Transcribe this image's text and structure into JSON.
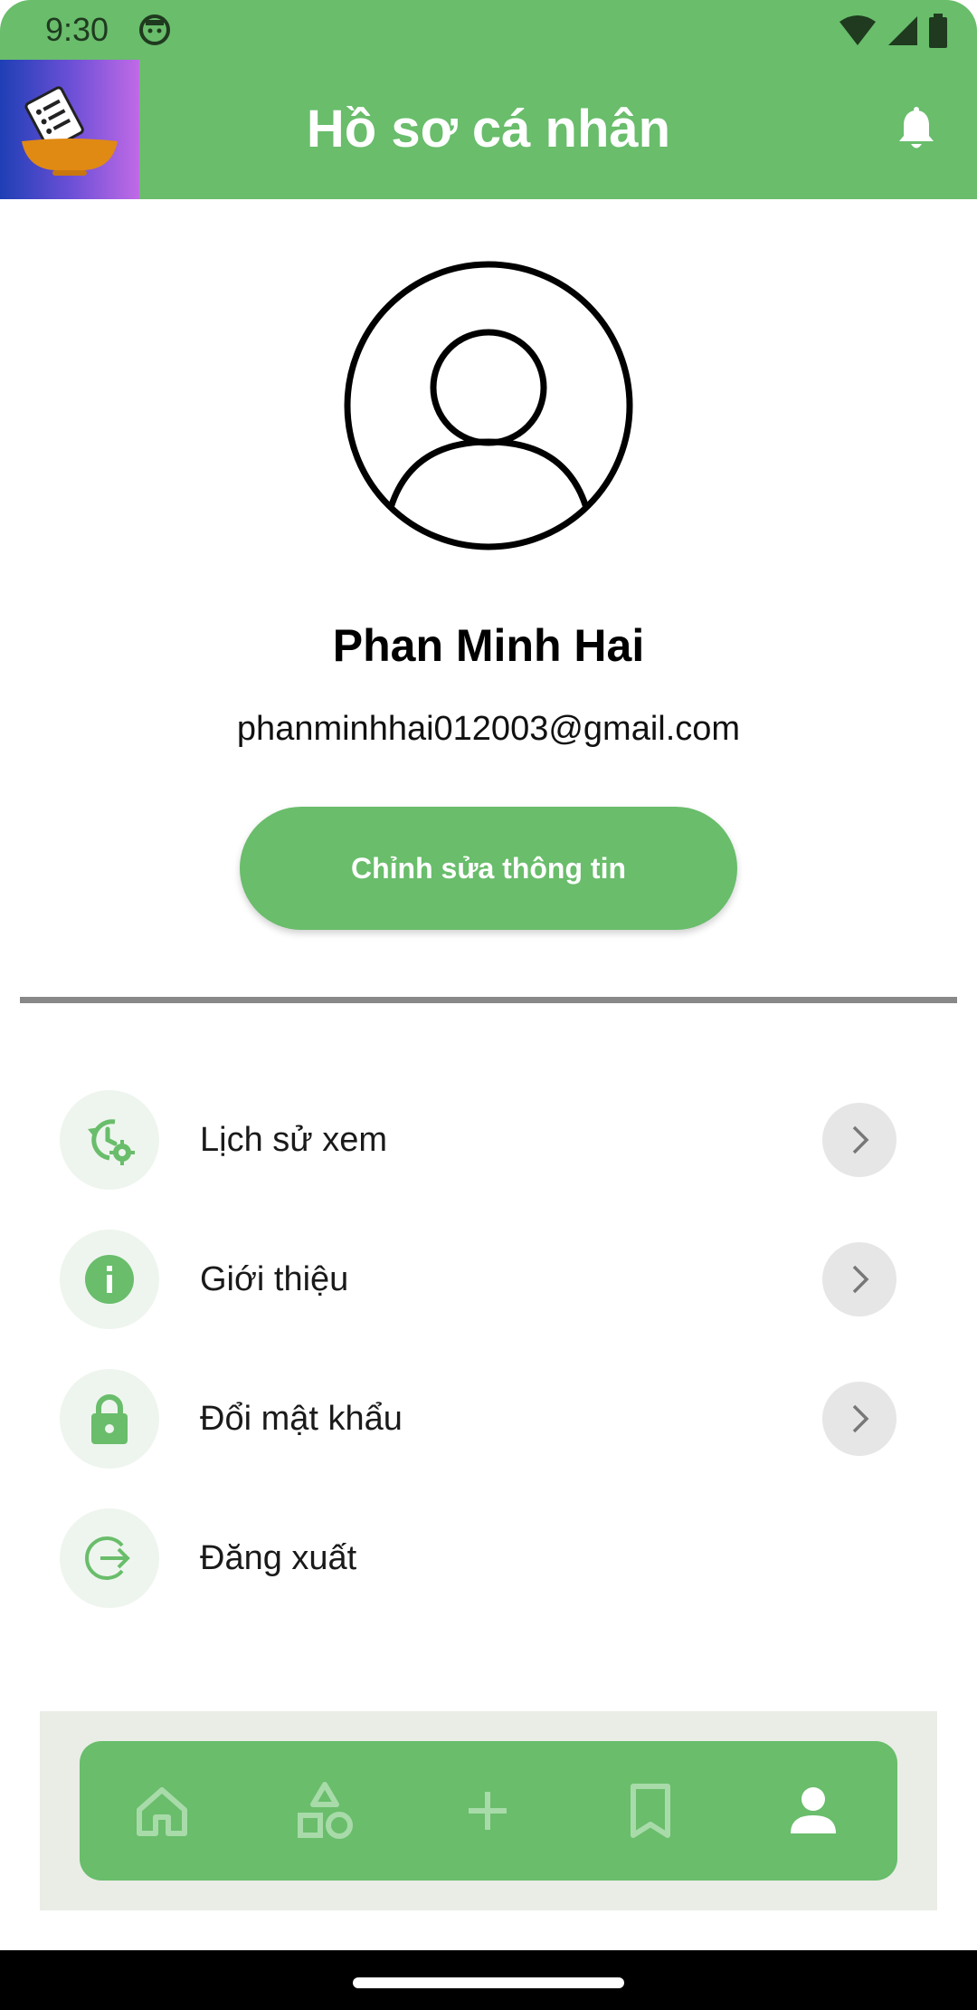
{
  "status_bar": {
    "time": "9:30",
    "icons": [
      "android-face-icon",
      "wifi-icon",
      "signal-icon",
      "battery-icon"
    ]
  },
  "app_bar": {
    "title": "Hồ sơ cá nhân",
    "logo_icon": "recipe-bowl-logo",
    "notification_icon": "bell-icon"
  },
  "profile": {
    "avatar_icon": "user-circle-icon",
    "name": "Phan Minh Hai",
    "email": "phanminhhai012003@gmail.com",
    "edit_button_label": "Chỉnh sửa thông tin"
  },
  "menu": {
    "items": [
      {
        "label": "Lịch sử xem",
        "icon": "history-settings-icon",
        "chevron": true
      },
      {
        "label": "Giới thiệu",
        "icon": "info-icon",
        "chevron": true
      },
      {
        "label": "Đổi mật khẩu",
        "icon": "lock-icon",
        "chevron": true
      },
      {
        "label": "Đăng xuất",
        "icon": "logout-icon",
        "chevron": false
      }
    ]
  },
  "bottom_nav": {
    "items": [
      {
        "icon": "home-icon",
        "active": false
      },
      {
        "icon": "categories-icon",
        "active": false
      },
      {
        "icon": "add-icon",
        "active": false
      },
      {
        "icon": "bookmark-icon",
        "active": false
      },
      {
        "icon": "person-icon",
        "active": true
      }
    ]
  },
  "colors": {
    "primary": "#69bd6b",
    "menu_icon_bg": "#eef5ee",
    "chevron_bg": "#e6e6e6",
    "divider": "#888888",
    "nav_background": "#e9ede6"
  }
}
